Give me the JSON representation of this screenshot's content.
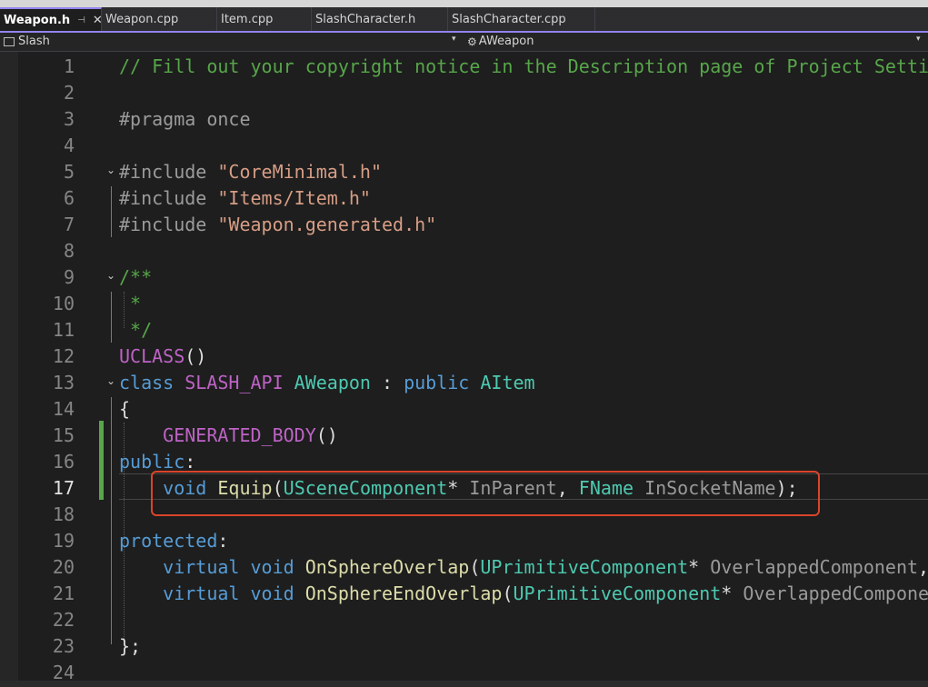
{
  "tabs": [
    {
      "label": "Weapon.h",
      "active": true
    },
    {
      "label": "Weapon.cpp"
    },
    {
      "label": "Item.cpp"
    },
    {
      "label": "SlashCharacter.h"
    },
    {
      "label": "SlashCharacter.cpp"
    }
  ],
  "nav": {
    "project": "Slash",
    "scope": "AWeapon"
  },
  "colors": {
    "accent": "#9184ee",
    "highlight_box": "#d9452a",
    "changed_lines": "#57a64a"
  },
  "editor": {
    "current_line": 17,
    "lines": [
      {
        "n": "1",
        "tokens": [
          [
            "c-comment",
            "// Fill out your copyright notice in the Description page of Project Settings."
          ]
        ]
      },
      {
        "n": "2",
        "tokens": []
      },
      {
        "n": "3",
        "tokens": [
          [
            "c-pp",
            "#pragma once"
          ]
        ]
      },
      {
        "n": "4",
        "tokens": []
      },
      {
        "n": "5",
        "tokens": [
          [
            "c-pp",
            "#include "
          ],
          [
            "c-str",
            "\"CoreMinimal.h\""
          ]
        ]
      },
      {
        "n": "6",
        "tokens": [
          [
            "c-pp",
            "#include "
          ],
          [
            "c-str",
            "\"Items/Item.h\""
          ]
        ]
      },
      {
        "n": "7",
        "tokens": [
          [
            "c-pp",
            "#include "
          ],
          [
            "c-str",
            "\"Weapon.generated.h\""
          ]
        ]
      },
      {
        "n": "8",
        "tokens": []
      },
      {
        "n": "9",
        "tokens": [
          [
            "c-comment",
            "/**"
          ]
        ]
      },
      {
        "n": "10",
        "tokens": [
          [
            "c-comment",
            " *"
          ]
        ]
      },
      {
        "n": "11",
        "tokens": [
          [
            "c-comment",
            " */"
          ]
        ]
      },
      {
        "n": "12",
        "tokens": [
          [
            "c-macro",
            "UCLASS"
          ],
          [
            "c-text",
            "()"
          ]
        ]
      },
      {
        "n": "13",
        "tokens": [
          [
            "c-kw",
            "class "
          ],
          [
            "c-macro",
            "SLASH_API "
          ],
          [
            "c-type",
            "AWeapon"
          ],
          [
            "c-text",
            " : "
          ],
          [
            "c-kw",
            "public "
          ],
          [
            "c-type",
            "AItem"
          ]
        ]
      },
      {
        "n": "14",
        "tokens": [
          [
            "c-text",
            "{"
          ]
        ]
      },
      {
        "n": "15",
        "tokens": [
          [
            "c-text",
            "    "
          ],
          [
            "c-macro",
            "GENERATED_BODY"
          ],
          [
            "c-text",
            "()"
          ]
        ]
      },
      {
        "n": "16",
        "tokens": [
          [
            "c-access",
            "public"
          ],
          [
            "c-text",
            ":"
          ]
        ]
      },
      {
        "n": "17",
        "tokens": [
          [
            "c-text",
            "    "
          ],
          [
            "c-kw",
            "void "
          ],
          [
            "c-func",
            "Equip"
          ],
          [
            "c-text",
            "("
          ],
          [
            "c-type",
            "USceneComponent"
          ],
          [
            "c-text",
            "* "
          ],
          [
            "c-param",
            "InParent"
          ],
          [
            "c-text",
            ", "
          ],
          [
            "c-type",
            "FName"
          ],
          [
            "c-text",
            " "
          ],
          [
            "c-param",
            "InSocketName"
          ],
          [
            "c-text",
            ");"
          ]
        ]
      },
      {
        "n": "18",
        "tokens": []
      },
      {
        "n": "19",
        "tokens": [
          [
            "c-access",
            "protected"
          ],
          [
            "c-text",
            ":"
          ]
        ]
      },
      {
        "n": "20",
        "tokens": [
          [
            "c-text",
            "    "
          ],
          [
            "c-kw",
            "virtual "
          ],
          [
            "c-kw",
            "void "
          ],
          [
            "c-func",
            "OnSphereOverlap"
          ],
          [
            "c-text",
            "("
          ],
          [
            "c-type",
            "UPrimitiveComponent"
          ],
          [
            "c-text",
            "* "
          ],
          [
            "c-param",
            "OverlappedComponent"
          ],
          [
            "c-text",
            ", "
          ]
        ]
      },
      {
        "n": "21",
        "tokens": [
          [
            "c-text",
            "    "
          ],
          [
            "c-kw",
            "virtual "
          ],
          [
            "c-kw",
            "void "
          ],
          [
            "c-func",
            "OnSphereEndOverlap"
          ],
          [
            "c-text",
            "("
          ],
          [
            "c-type",
            "UPrimitiveComponent"
          ],
          [
            "c-text",
            "* "
          ],
          [
            "c-param",
            "OverlappedComponent"
          ]
        ]
      },
      {
        "n": "22",
        "tokens": []
      },
      {
        "n": "23",
        "tokens": [
          [
            "c-text",
            "};"
          ]
        ]
      },
      {
        "n": "24",
        "tokens": []
      }
    ]
  }
}
